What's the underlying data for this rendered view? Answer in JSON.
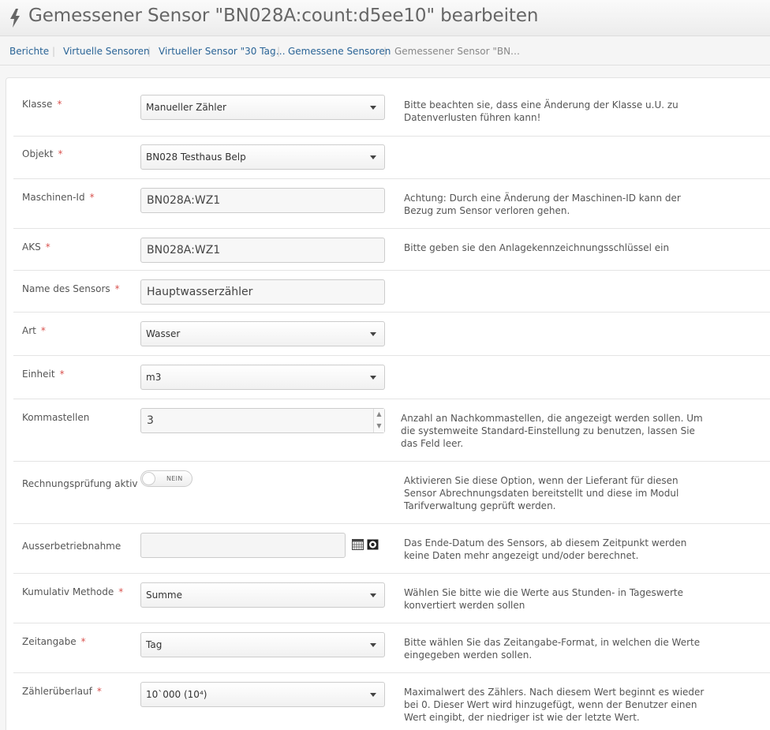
{
  "header": {
    "title": "Gemessener Sensor \"BN028A:count:d5ee10\" bearbeiten",
    "icon": "lightning-icon"
  },
  "breadcrumb": {
    "items": [
      "Berichte",
      "Virtuelle Sensoren",
      "Virtueller Sensor \"30 Tag…",
      "Gemessene Sensoren"
    ],
    "current": "Gemessener Sensor \"BN…"
  },
  "form": {
    "klasse": {
      "label": "Klasse",
      "value": "Manueller Zähler",
      "help": "Bitte beachten sie, dass eine Änderung der Klasse u.U. zu Datenverlusten führen kann!"
    },
    "objekt": {
      "label": "Objekt",
      "value": "BN028 Testhaus Belp"
    },
    "maschinen_id": {
      "label": "Maschinen-Id",
      "value": "BN028A:WZ1",
      "help": "Achtung: Durch eine Änderung der Maschinen-ID kann der Bezug zum Sensor verloren gehen."
    },
    "aks": {
      "label": "AKS",
      "value": "BN028A:WZ1",
      "help": "Bitte geben sie den Anlagekennzeichnungsschlüssel ein"
    },
    "name": {
      "label": "Name des Sensors",
      "value": "Hauptwasserzähler"
    },
    "art": {
      "label": "Art",
      "value": "Wasser"
    },
    "einheit": {
      "label": "Einheit",
      "value": "m3"
    },
    "kommastellen": {
      "label": "Kommastellen",
      "value": "3",
      "help": "Anzahl an Nachkommastellen, die angezeigt werden sollen. Um die systemweite Standard-Einstellung zu benutzen, lassen Sie das Feld leer."
    },
    "rechnungspruefung": {
      "label": "Rechnungsprüfung aktiv",
      "toggle": "NEIN",
      "help": "Aktivieren Sie diese Option, wenn der Lieferant für diesen Sensor Abrechnungsdaten bereitstellt und diese im Modul Tarifverwaltung geprüft werden."
    },
    "ausserbetrieb": {
      "label": "Ausserbetriebnahme",
      "value": "",
      "help": "Das Ende-Datum des Sensors, ab diesem Zeitpunkt werden keine Daten mehr angezeigt und/oder berechnet."
    },
    "kumulativ": {
      "label": "Kumulativ Methode",
      "value": "Summe",
      "help": "Wählen Sie bitte wie die Werte aus Stunden- in Tageswerte konvertiert werden sollen"
    },
    "zeitangabe": {
      "label": "Zeitangabe",
      "value": "Tag",
      "help": "Bitte wählen Sie das Zeitangabe-Format, in welchen die Werte eingegeben werden sollen."
    },
    "ueberlauf": {
      "label": "Zählerüberlauf",
      "value": "10`000 (10⁴)",
      "help": "Maximalwert des Zählers. Nach diesem Wert beginnt es wieder bei 0. Dieser Wert wird hinzugefügt, wenn der Benutzer einen Wert eingibt, der niedriger ist wie der letzte Wert."
    }
  },
  "required_marker": "*",
  "colors": {
    "link": "#2a6496",
    "required": "#d9534f"
  }
}
